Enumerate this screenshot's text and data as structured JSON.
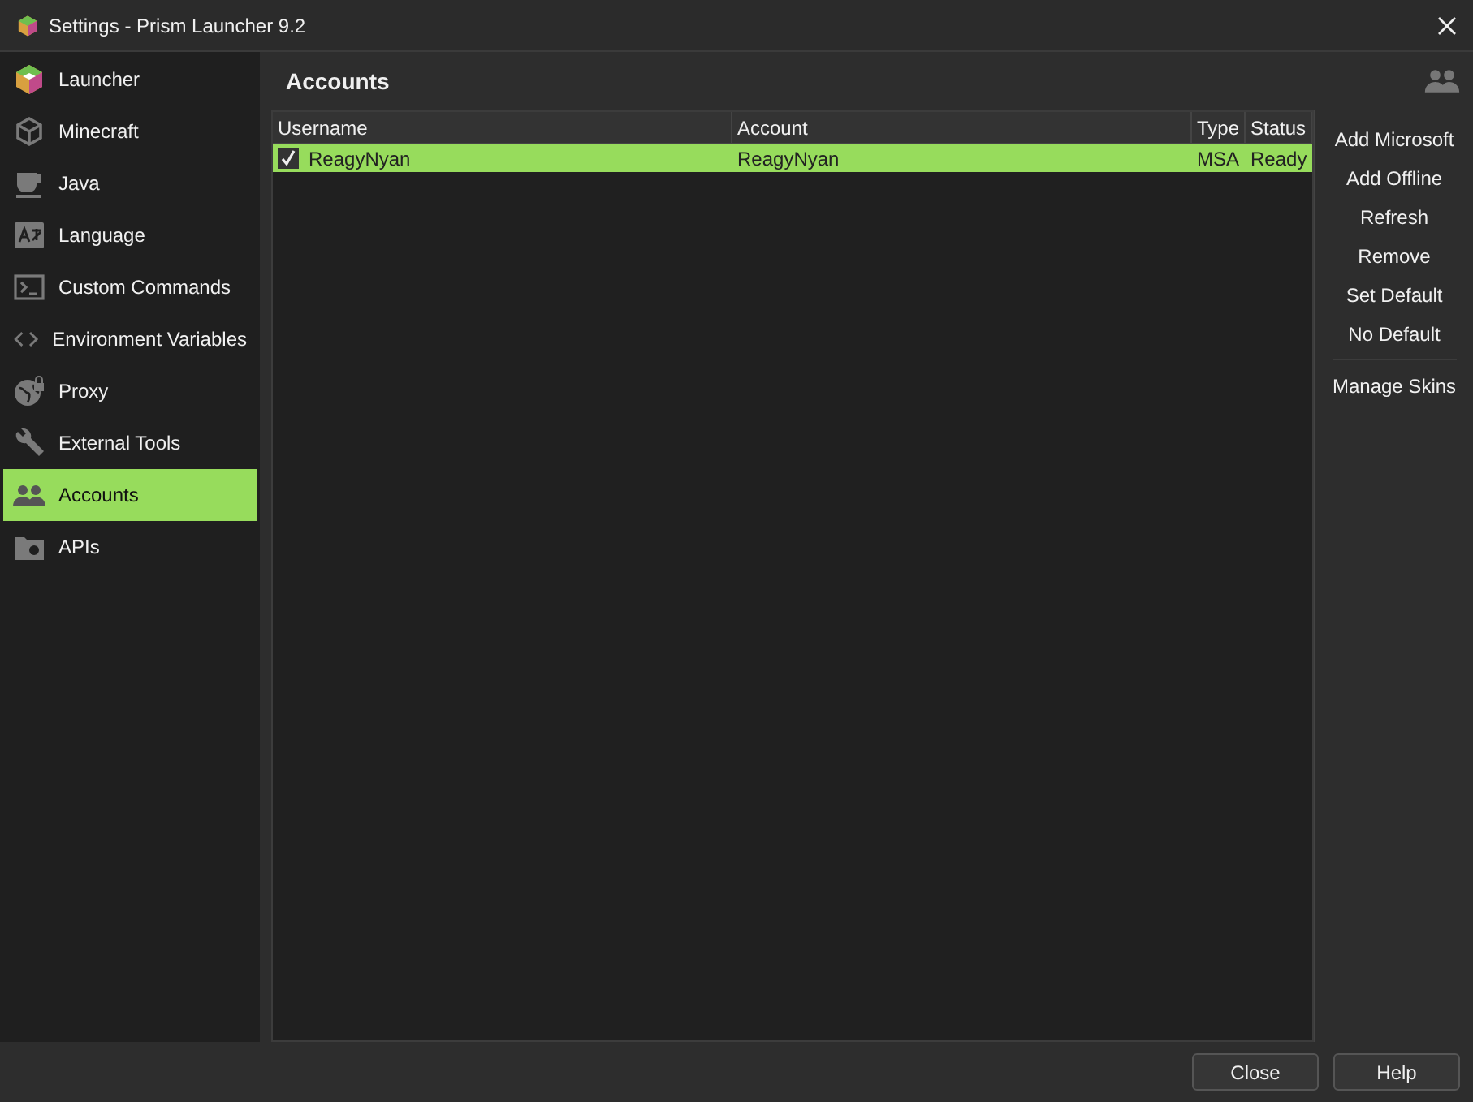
{
  "window": {
    "title": "Settings - Prism Launcher 9.2"
  },
  "sidebar": {
    "items": [
      {
        "label": "Launcher",
        "kind": "logo",
        "selected": false
      },
      {
        "label": "Minecraft",
        "kind": "cube",
        "selected": false
      },
      {
        "label": "Java",
        "kind": "cup",
        "selected": false
      },
      {
        "label": "Language",
        "kind": "translate",
        "selected": false
      },
      {
        "label": "Custom Commands",
        "kind": "terminal",
        "selected": false
      },
      {
        "label": "Environment Variables",
        "kind": "code",
        "selected": false
      },
      {
        "label": "Proxy",
        "kind": "globe",
        "selected": false
      },
      {
        "label": "External Tools",
        "kind": "wrench",
        "selected": false
      },
      {
        "label": "Accounts",
        "kind": "people",
        "selected": true
      },
      {
        "label": "APIs",
        "kind": "folder",
        "selected": false
      }
    ]
  },
  "page": {
    "title": "Accounts"
  },
  "table": {
    "columns": [
      "Username",
      "Account",
      "Type",
      "Status"
    ],
    "rows": [
      {
        "checked": true,
        "selected": true,
        "cells": [
          "ReagyNyan",
          "ReagyNyan",
          "MSA",
          "Ready"
        ]
      }
    ]
  },
  "actions": [
    {
      "label": "Add Microsoft",
      "separated": false
    },
    {
      "label": "Add Offline",
      "separated": false
    },
    {
      "label": "Refresh",
      "separated": false
    },
    {
      "label": "Remove",
      "separated": false
    },
    {
      "label": "Set Default",
      "separated": false
    },
    {
      "label": "No Default",
      "separated": false
    },
    {
      "label": "Manage Skins",
      "separated": true
    }
  ],
  "buttons": [
    "Close",
    "Help"
  ]
}
